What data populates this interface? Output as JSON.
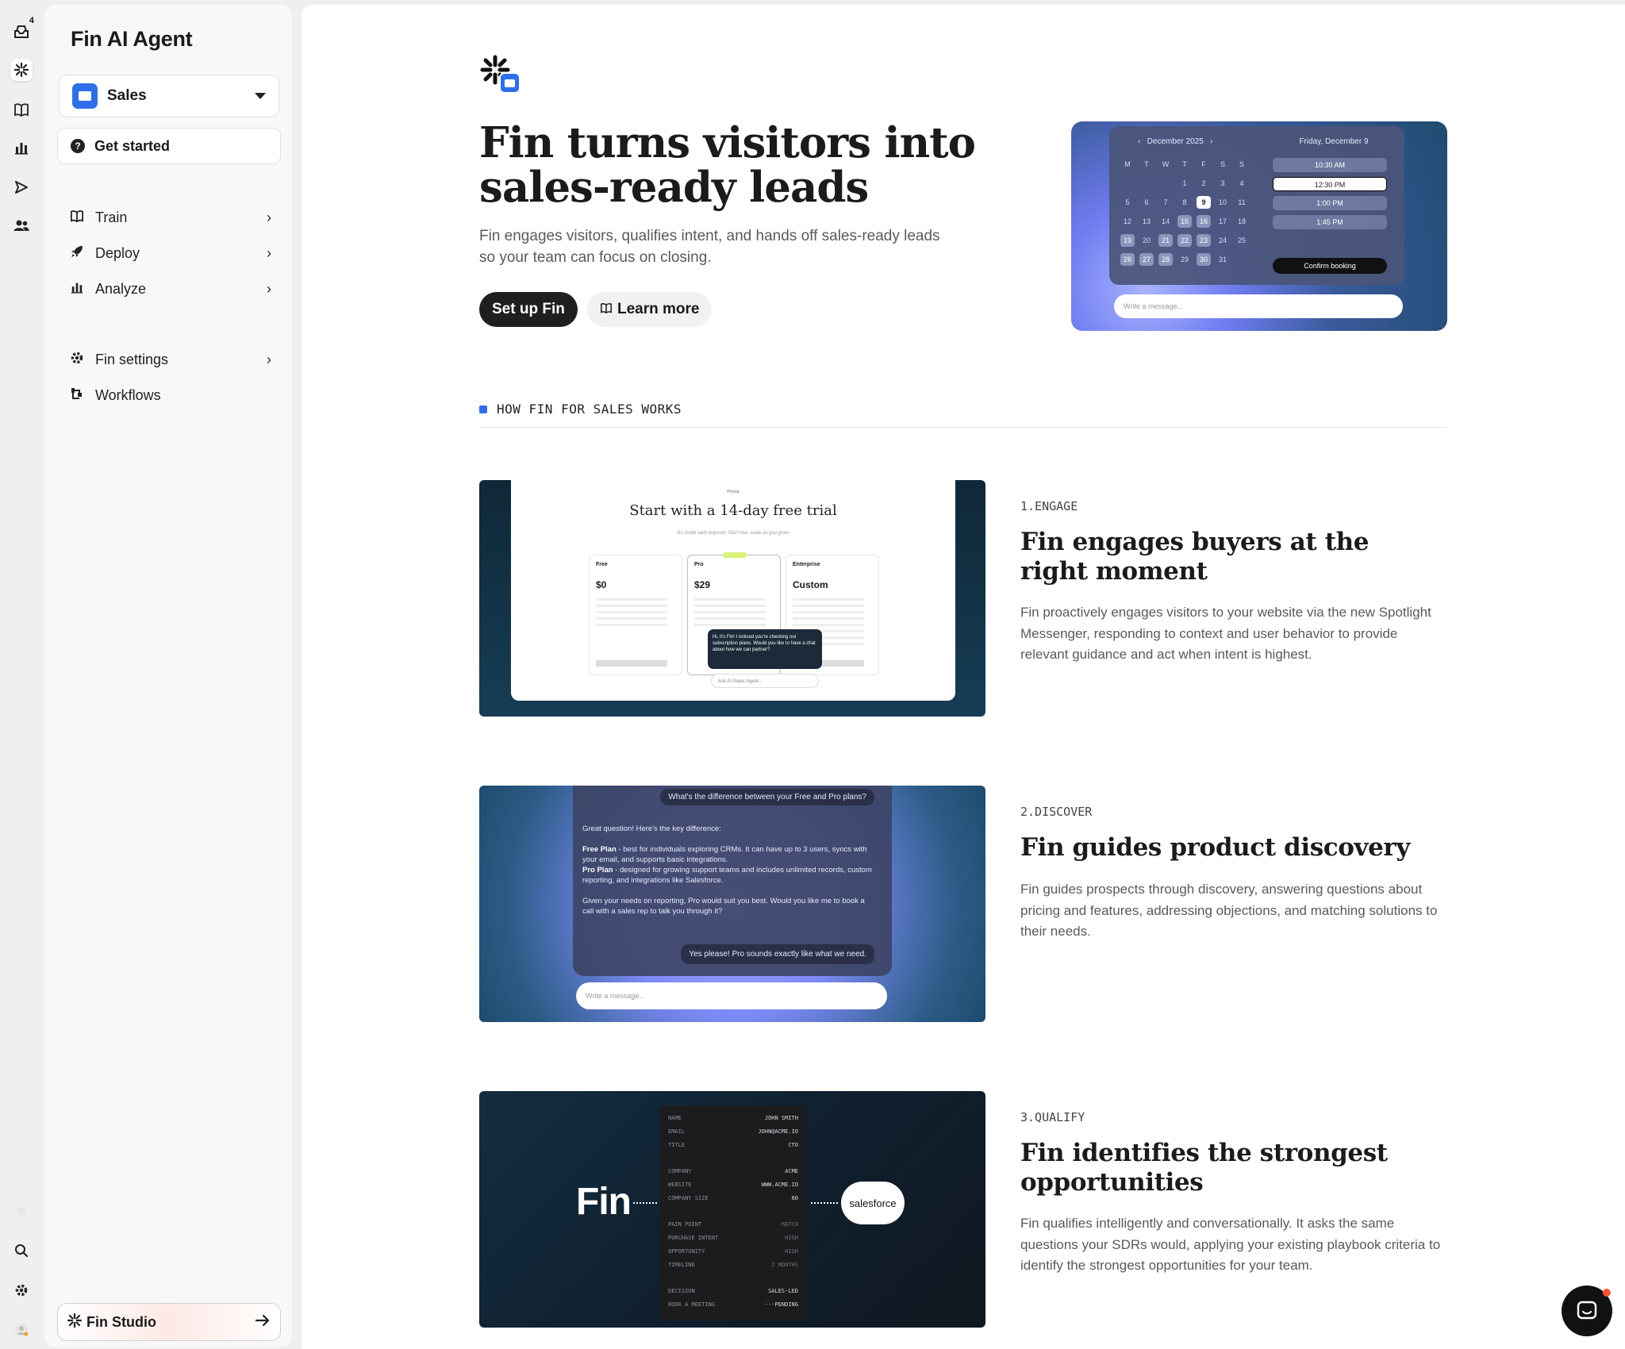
{
  "rail": {
    "notification_count": "4",
    "icons": [
      "inbox-icon",
      "fin-icon",
      "book-icon",
      "reports-icon",
      "outbound-icon",
      "contacts-icon",
      "search-icon",
      "settings-icon",
      "user-avatar-icon"
    ]
  },
  "sidebar": {
    "title": "Fin AI Agent",
    "selector_label": "Sales",
    "get_started": "Get started",
    "nav": [
      {
        "label": "Train",
        "icon": "book-icon"
      },
      {
        "label": "Deploy",
        "icon": "rocket-icon"
      },
      {
        "label": "Analyze",
        "icon": "chart-icon"
      },
      {
        "label": "Fin settings",
        "icon": "gear-icon"
      },
      {
        "label": "Workflows",
        "icon": "workflow-icon"
      }
    ],
    "studio_label": "Fin Studio"
  },
  "hero": {
    "title": "Fin turns visitors into sales-ready leads",
    "subtitle": "Fin engages visitors, qualifies intent, and hands off sales-ready leads so your team can focus on closing.",
    "primary_button": "Set up Fin",
    "secondary_button": "Learn more",
    "calendar": {
      "month": "December 2025",
      "weekdays": [
        "M",
        "T",
        "W",
        "T",
        "F",
        "S",
        "S"
      ],
      "days": [
        "1",
        "2",
        "3",
        "4",
        "5",
        "6",
        "7",
        "8",
        "9",
        "10",
        "11",
        "12",
        "13",
        "14",
        "15",
        "16",
        "17",
        "18",
        "19",
        "20",
        "21",
        "22",
        "23",
        "24",
        "25",
        "26",
        "27",
        "28",
        "29",
        "30",
        "31"
      ],
      "date_label": "Friday, December 9",
      "slots": [
        "10:30 AM",
        "12:30 PM",
        "1:00 PM",
        "1:45 PM"
      ],
      "confirm": "Confirm booking",
      "placeholder": "Write a message..."
    }
  },
  "section_label": "HOW FIN FOR SALES WORKS",
  "features": [
    {
      "number": "1.ENGAGE",
      "title": "Fin engages buyers at the right moment",
      "description": "Fin proactively engages visitors to your website via the new Spotlight Messenger, responding to context and user behavior to provide relevant guidance and act when intent is highest.",
      "image": {
        "label": "Pricing",
        "heading": "Start with a 14-day free trial",
        "sub": "No credit card required. Start free, scale as you grow.",
        "tiers": [
          {
            "name": "Free",
            "price": "$0"
          },
          {
            "name": "Pro",
            "price": "$29"
          },
          {
            "name": "Enterprise",
            "price": "Custom"
          }
        ],
        "chat": "Hi, it's Fin! I noticed you're checking our subscription plans. Would you like to have a chat about how we can partner?",
        "ask": "Ask AI Sales Agent..."
      }
    },
    {
      "number": "2.DISCOVER",
      "title": "Fin guides product discovery",
      "description": "Fin guides prospects through discovery, answering questions about pricing and features, addressing objections, and matching solutions to their needs.",
      "image": {
        "question": "What's the difference between your Free and Pro plans?",
        "answer_intro": "Great question! Here's the key difference:",
        "free_label": "Free Plan",
        "free_text": " - best for individuals exploring CRMs. It can have up to 3 users, syncs with your email, and supports basic integrations.",
        "pro_label": "Pro Plan",
        "pro_text": " - designed for growing support teams and includes unlimited records, custom reporting, and integrations like Salesforce.",
        "answer_end": "Given your needs on reporting, Pro would suit you best. Would you like me to book a call with a sales rep to talk you through it?",
        "reply": "Yes please! Pro sounds exactly like what we need.",
        "placeholder": "Write a message..."
      }
    },
    {
      "number": "3.QUALIFY",
      "title": "Fin identifies the strongest opportunities",
      "description": "Fin qualifies intelligently and conversationally. It asks the same questions your SDRs would, applying your existing playbook criteria to identify the strongest opportunities for your team.",
      "image": {
        "fin": "Fin",
        "salesforce": "salesforce",
        "rows": [
          {
            "k": "NAME",
            "v": "JOHN SMITH"
          },
          {
            "k": "EMAIL",
            "v": "JOHN@ACME.IO"
          },
          {
            "k": "TITLE",
            "v": "CTO"
          },
          {
            "k": "COMPANY",
            "v": "ACME"
          },
          {
            "k": "WEBSITE",
            "v": "WWW.ACME.IO"
          },
          {
            "k": "COMPANY SIZE",
            "v": "60"
          },
          {
            "k": "PAIN POINT",
            "v": "MATCH"
          },
          {
            "k": "PURCHASE INTENT",
            "v": "HIGH"
          },
          {
            "k": "OPPORTUNITY",
            "v": "HIGH"
          },
          {
            "k": "TIMELINE",
            "v": "2 MONTHS"
          },
          {
            "k": "DECISION",
            "v": "SALES-LED"
          },
          {
            "k": "BOOK A MEETING",
            "v": "···PENDING"
          }
        ]
      }
    }
  ]
}
